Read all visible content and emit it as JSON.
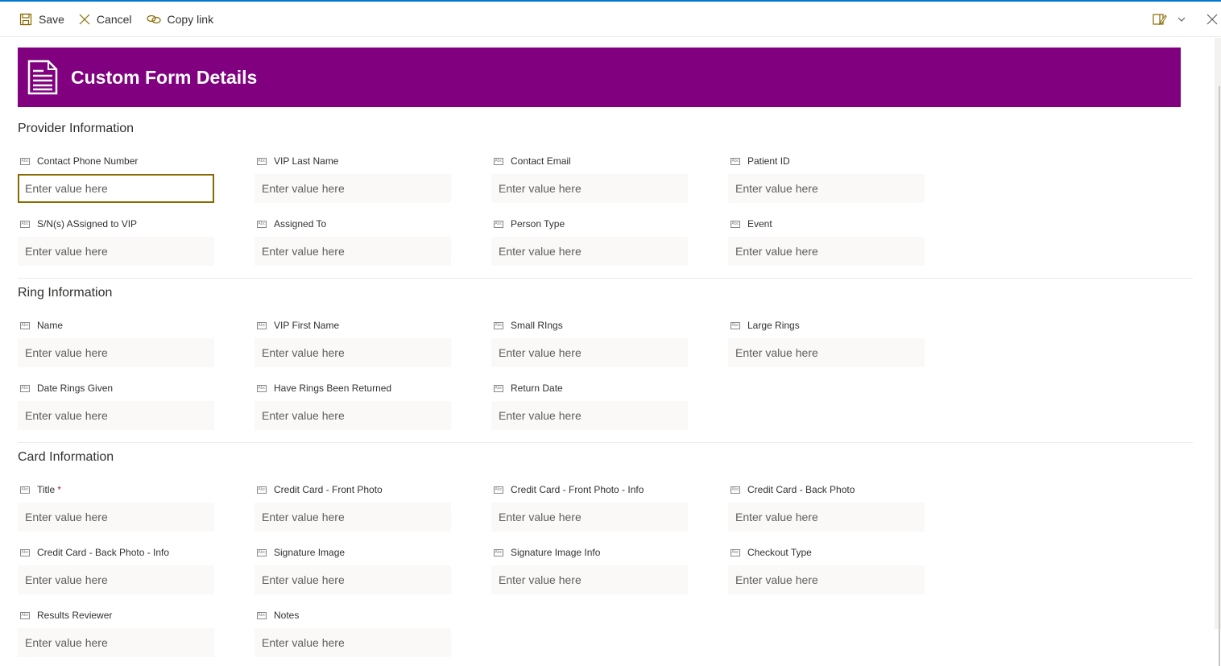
{
  "command_bar": {
    "save_label": "Save",
    "cancel_label": "Cancel",
    "copy_link_label": "Copy link",
    "accent_color": "#8a6a00"
  },
  "banner": {
    "title": "Custom Form Details",
    "background_color": "#800080",
    "icon": "document-icon"
  },
  "sections": [
    {
      "title": "Provider Information",
      "fields": [
        {
          "label": "Contact Phone Number",
          "placeholder": "Enter value here",
          "value": "",
          "required": false,
          "focused": true
        },
        {
          "label": "VIP Last Name",
          "placeholder": "Enter value here",
          "value": "",
          "required": false
        },
        {
          "label": "Contact Email",
          "placeholder": "Enter value here",
          "value": "",
          "required": false
        },
        {
          "label": "Patient ID",
          "placeholder": "Enter value here",
          "value": "",
          "required": false
        },
        {
          "label": "S/N(s) ASsigned to VIP",
          "placeholder": "Enter value here",
          "value": "",
          "required": false
        },
        {
          "label": "Assigned To",
          "placeholder": "Enter value here",
          "value": "",
          "required": false
        },
        {
          "label": "Person Type",
          "placeholder": "Enter value here",
          "value": "",
          "required": false
        },
        {
          "label": "Event",
          "placeholder": "Enter value here",
          "value": "",
          "required": false
        }
      ]
    },
    {
      "title": "Ring Information",
      "fields": [
        {
          "label": "Name",
          "placeholder": "Enter value here",
          "value": "",
          "required": false
        },
        {
          "label": "VIP First Name",
          "placeholder": "Enter value here",
          "value": "",
          "required": false
        },
        {
          "label": "Small RIngs",
          "placeholder": "Enter value here",
          "value": "",
          "required": false
        },
        {
          "label": "Large Rings",
          "placeholder": "Enter value here",
          "value": "",
          "required": false
        },
        {
          "label": "Date Rings Given",
          "placeholder": "Enter value here",
          "value": "",
          "required": false
        },
        {
          "label": "Have Rings Been Returned",
          "placeholder": "Enter value here",
          "value": "",
          "required": false
        },
        {
          "label": "Return Date",
          "placeholder": "Enter value here",
          "value": "",
          "required": false
        }
      ]
    },
    {
      "title": "Card Information",
      "fields": [
        {
          "label": "Title",
          "placeholder": "Enter value here",
          "value": "",
          "required": true
        },
        {
          "label": "Credit Card - Front Photo",
          "placeholder": "Enter value here",
          "value": "",
          "required": false
        },
        {
          "label": "Credit Card - Front Photo - Info",
          "placeholder": "Enter value here",
          "value": "",
          "required": false
        },
        {
          "label": "Credit Card - Back Photo",
          "placeholder": "Enter value here",
          "value": "",
          "required": false
        },
        {
          "label": "Credit Card - Back Photo - Info",
          "placeholder": "Enter value here",
          "value": "",
          "required": false
        },
        {
          "label": "Signature Image",
          "placeholder": "Enter value here",
          "value": "",
          "required": false
        },
        {
          "label": "Signature Image Info",
          "placeholder": "Enter value here",
          "value": "",
          "required": false
        },
        {
          "label": "Checkout Type",
          "placeholder": "Enter value here",
          "value": "",
          "required": false
        },
        {
          "label": "Results Reviewer",
          "placeholder": "Enter value here",
          "value": "",
          "required": false
        },
        {
          "label": "Notes",
          "placeholder": "Enter value here",
          "value": "",
          "required": false
        }
      ]
    }
  ],
  "required_marker": "*",
  "field_type_icon_text": "Abc"
}
